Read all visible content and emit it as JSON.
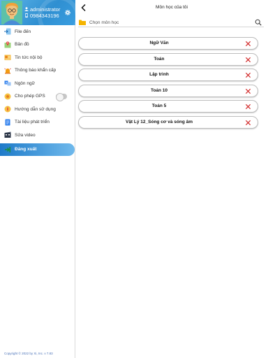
{
  "sidebar": {
    "user": {
      "name": "administrator",
      "phone": "0984343196"
    },
    "items": [
      {
        "label": "File đến",
        "icon": "file-incoming-icon"
      },
      {
        "label": "Bản đồ",
        "icon": "map-icon"
      },
      {
        "label": "Tin tức nội bộ",
        "icon": "news-icon"
      },
      {
        "label": "Thông báo khẩn cấp",
        "icon": "alarm-icon"
      },
      {
        "label": "Ngôn ngữ",
        "icon": "language-icon"
      },
      {
        "label": "Cho phép GPS",
        "icon": "gps-icon",
        "toggle": false
      },
      {
        "label": "Hướng dẫn sử dụng",
        "icon": "guide-icon"
      },
      {
        "label": "Tài liệu phát triển",
        "icon": "document-icon"
      },
      {
        "label": "Sửa video",
        "icon": "video-edit-icon"
      }
    ],
    "logout_label": "Đăng xuất",
    "copyright": "Copyright © 2022 by Xi, Inc. v 7.83"
  },
  "main": {
    "title": "Môn học của tôi",
    "search": {
      "placeholder": "Chọn môn học"
    },
    "subjects": [
      {
        "label": "Ngữ Văn"
      },
      {
        "label": "Toán"
      },
      {
        "label": "Lập trình"
      },
      {
        "label": "Toán 10"
      },
      {
        "label": "Toán 5"
      },
      {
        "label": "Vật Lý 12_Sóng cơ và sóng âm"
      }
    ]
  },
  "colors": {
    "accent": "#2f8fd1",
    "remove": "#d32f2f",
    "folder": "#f5b400"
  }
}
